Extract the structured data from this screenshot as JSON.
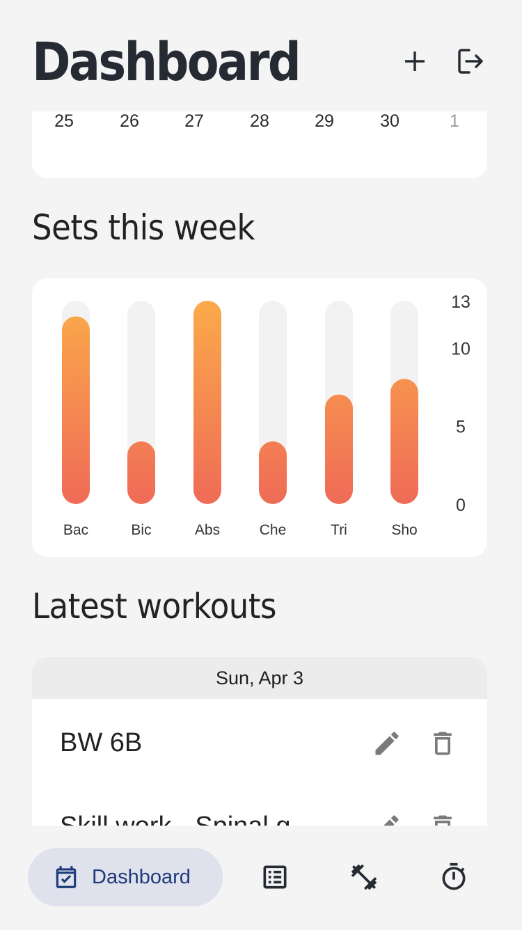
{
  "header": {
    "title": "Dashboard"
  },
  "calendar": {
    "days": [
      {
        "label": "25",
        "muted": false
      },
      {
        "label": "26",
        "muted": false
      },
      {
        "label": "27",
        "muted": false
      },
      {
        "label": "28",
        "muted": false
      },
      {
        "label": "29",
        "muted": false
      },
      {
        "label": "30",
        "muted": false
      },
      {
        "label": "1",
        "muted": true
      }
    ]
  },
  "sets_section": {
    "title": "Sets this week"
  },
  "chart_data": {
    "type": "bar",
    "categories": [
      "Bac",
      "Bic",
      "Abs",
      "Che",
      "Tri",
      "Sho"
    ],
    "values": [
      12,
      4,
      13,
      4,
      7,
      8
    ],
    "ylim": [
      0,
      13
    ],
    "yticks": [
      0,
      5,
      10,
      13
    ],
    "grid": false,
    "colors": {
      "bar_top": "#fbaa4a",
      "bar_bottom": "#ef6b57",
      "track": "#f2f2f2"
    }
  },
  "latest_section": {
    "title": "Latest workouts"
  },
  "workouts": {
    "date_label": "Sun, Apr 3",
    "items": [
      {
        "name": "BW 6B"
      },
      {
        "name": "Skill work - Spinal g"
      }
    ]
  },
  "nav": {
    "active_label": "Dashboard",
    "items": [
      "calendar-icon",
      "list-icon",
      "dumbbell-icon",
      "timer-icon"
    ]
  }
}
